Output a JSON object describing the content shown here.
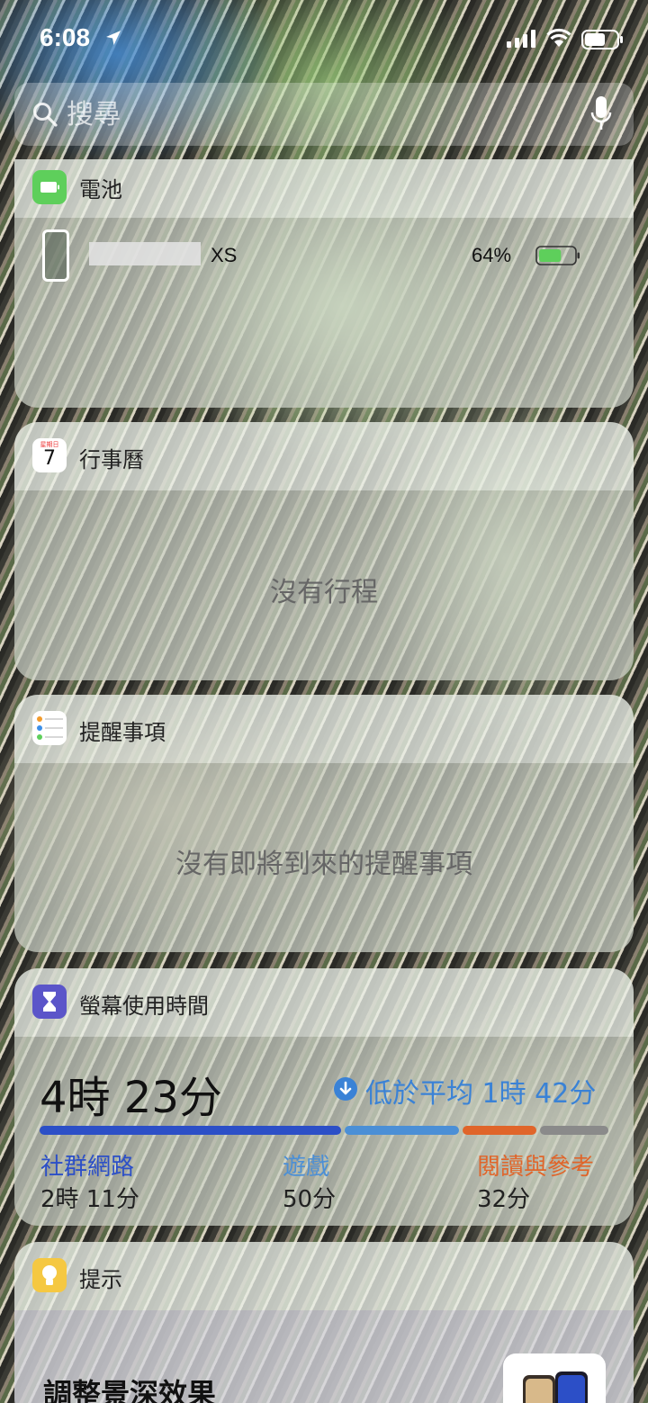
{
  "status": {
    "time": "6:08"
  },
  "search": {
    "placeholder": "搜尋"
  },
  "battery": {
    "title": "電池",
    "device_name": "XS",
    "percent": "64%",
    "level": 0.64,
    "color": "#5ecf5b"
  },
  "calendar": {
    "title": "行事曆",
    "icon_day": "星期日",
    "icon_date": "7",
    "empty_message": "沒有行程"
  },
  "reminders": {
    "title": "提醒事項",
    "empty_message": "沒有即將到來的提醒事項"
  },
  "screen_time": {
    "title": "螢幕使用時間",
    "total": "4時 23分",
    "comparison": "低於平均 1時 42分",
    "categories": [
      {
        "label": "社群網路",
        "value": "2時 11分",
        "minutes": 131,
        "color": "#2c4fc7"
      },
      {
        "label": "遊戲",
        "value": "50分",
        "minutes": 50,
        "color": "#4b8fd6"
      },
      {
        "label": "閱讀與參考",
        "value": "32分",
        "minutes": 32,
        "color": "#e0652a"
      }
    ],
    "other_color": "#8a8a8a"
  },
  "tips": {
    "title": "提示",
    "headline": "調整景深效果"
  }
}
